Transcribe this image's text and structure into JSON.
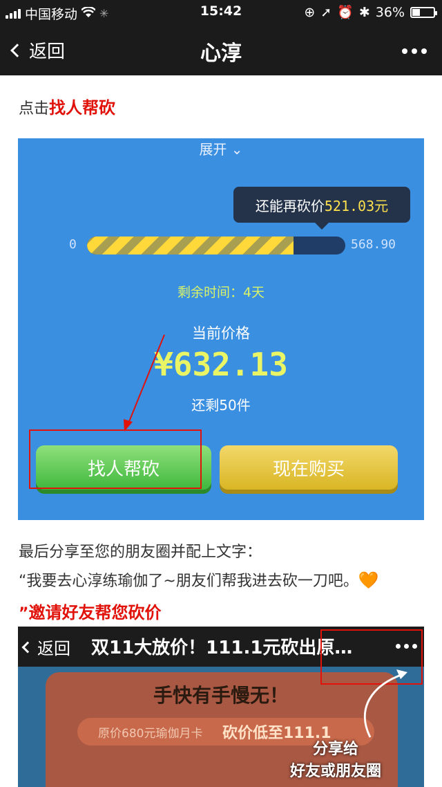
{
  "status_bar": {
    "carrier": "中国移动",
    "time": "15:42",
    "battery": "36%",
    "battery_level": 0.36
  },
  "nav": {
    "back_label": "返回",
    "title": "心淳"
  },
  "article": {
    "line1_prefix": "点击",
    "line1_highlight": "找人帮砍",
    "line2": "最后分享至您的朋友圈并配上文字：",
    "line3": "“我要去心淳练瑜伽了~朋友们帮我进去砍一刀吧。",
    "line3_emoji": "🧡",
    "line4_quote": "”",
    "line4_highlight": "邀请好友帮您砍价"
  },
  "bargain_screen": {
    "expand_label": "展开",
    "tooltip_text": "还能再砍价",
    "tooltip_value": "521.03元",
    "progress_min": "0",
    "progress_max": "568.90",
    "progress_fraction": 0.8,
    "remaining_time": "剩余时间：4天",
    "current_price_label": "当前价格",
    "current_price": "¥632.13",
    "stock_left": "还剩50件",
    "help_button": "找人帮砍",
    "buy_button": "现在购买"
  },
  "share_screen": {
    "back_label": "返回",
    "title": "双11大放价！111.1元砍出原…",
    "poster_headline": "手快有手慢无！",
    "poster_original_price": "原价680元瑜伽月卡",
    "poster_low_price": "砍价低至111.1",
    "share_hint_line1": "分享给",
    "share_hint_line2": "好友或朋友圈"
  },
  "colors": {
    "accent_red": "#e0120a",
    "screen_blue": "#3a8fe0",
    "help_green": "#3fb83e",
    "buy_gold": "#d9b624"
  }
}
